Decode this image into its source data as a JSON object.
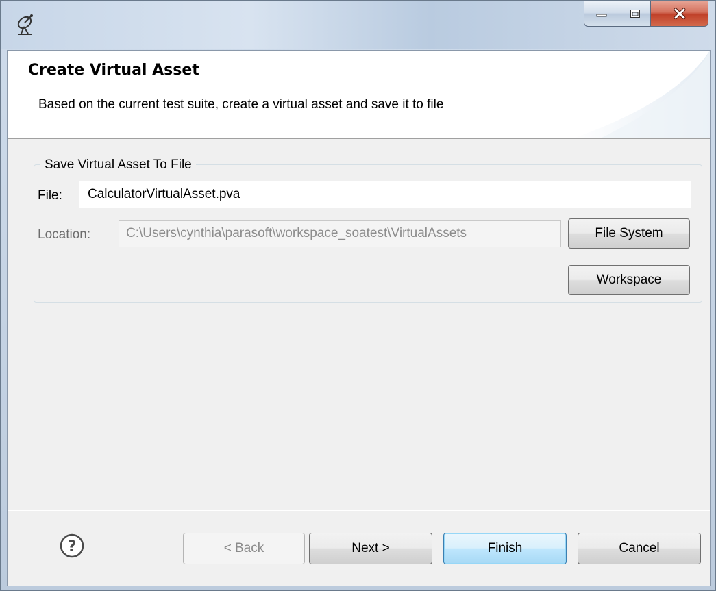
{
  "window": {
    "icon": "satellite-dish-icon",
    "caption_buttons": [
      "minimize-icon",
      "maximize-icon",
      "close-icon"
    ]
  },
  "banner": {
    "title": "Create Virtual Asset",
    "description": "Based on the current test suite, create a virtual asset and save it to file"
  },
  "group": {
    "legend": "Save Virtual Asset To File",
    "file_label": "File:",
    "file_value": "CalculatorVirtualAsset.pva",
    "location_label": "Location:",
    "location_value": "C:\\Users\\cynthia\\parasoft\\workspace_soatest\\VirtualAssets",
    "file_system_label": "File System",
    "workspace_label": "Workspace"
  },
  "footer": {
    "help_icon": "help-icon",
    "back_label": "< Back",
    "next_label": "Next >",
    "finish_label": "Finish",
    "cancel_label": "Cancel"
  }
}
